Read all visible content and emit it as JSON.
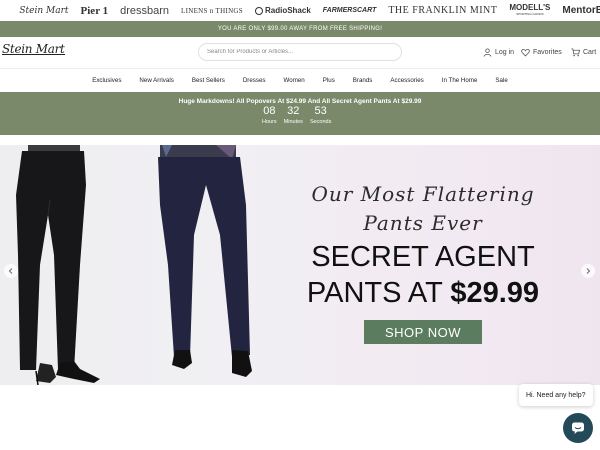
{
  "brands": [
    "Stein Mart",
    "Pier 1",
    "dressbarn",
    "LINENS n THINGS",
    "RadioShack",
    "FARMERSCART",
    "THE FRANKLIN MINT",
    "MODELL'S",
    "SPORTING GOODS",
    "MentorBox"
  ],
  "shipping_bar": "YOU ARE ONLY $99.00 AWAY FROM FREE SHIPPING!",
  "header": {
    "logo": "Stein Mart",
    "search_placeholder": "Search for Products or Articles...",
    "login": "Log in",
    "favorites": "Favorites",
    "cart": "Cart"
  },
  "nav": [
    "Exclusives",
    "New Arrivals",
    "Best Sellers",
    "Dresses",
    "Women",
    "Plus",
    "Brands",
    "Accessories",
    "In The Home",
    "Sale"
  ],
  "promo": {
    "text": "Huge Markdowns! All Popovers At $24.99 And All Secret Agent Pants At $29.99",
    "countdown": [
      {
        "value": "08",
        "label": "Hours"
      },
      {
        "value": "32",
        "label": "Minutes"
      },
      {
        "value": "53",
        "label": "Seconds"
      }
    ]
  },
  "hero": {
    "script_line1": "Our Most Flattering",
    "script_line2": "Pants Ever",
    "headline_line1": "SECRET AGENT",
    "headline_line2_prefix": "PANTS AT ",
    "headline_price": "$29.99",
    "cta": "SHOP NOW"
  },
  "chat": {
    "bubble": "Hi. Need any help?"
  },
  "colors": {
    "accent_green": "#79896a",
    "cta_green": "#5b7c5e",
    "chat_button": "#244a5a"
  },
  "icons": [
    "user-icon",
    "heart-icon",
    "cart-icon",
    "chevron-left-icon",
    "chevron-right-icon",
    "chat-icon"
  ]
}
